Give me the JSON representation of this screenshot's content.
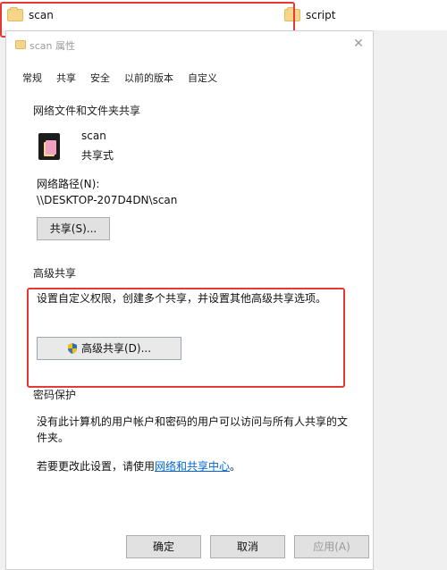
{
  "explorer": {
    "files": [
      {
        "name": "scan"
      },
      {
        "name": "script"
      }
    ]
  },
  "dialog": {
    "title": "scan 属性",
    "tabs": [
      "常规",
      "共享",
      "安全",
      "以前的版本",
      "自定义"
    ],
    "active_tab": "共享",
    "network_sharing": {
      "section_title": "网络文件和文件夹共享",
      "item_name": "scan",
      "item_status": "共享式",
      "path_label": "网络路径(N):",
      "path_value": "\\\\DESKTOP-207D4DN\\scan",
      "share_button": "共享(S)..."
    },
    "advanced_sharing": {
      "section_title": "高级共享",
      "description": "设置自定义权限，创建多个共享，并设置其他高级共享选项。",
      "button": "高级共享(D)..."
    },
    "password_protection": {
      "section_title": "密码保护",
      "description_line1": "没有此计算机的用户帐户和密码的用户可以访问与所有人共享的文",
      "description_line2": "件夹。",
      "change_prefix": "若要更改此设置，请使用",
      "change_link": "网络和共享中心",
      "change_suffix": "。"
    },
    "buttons": {
      "ok": "确定",
      "cancel": "取消",
      "apply": "应用(A)"
    }
  },
  "colors": {
    "highlight_box": "#e53935",
    "link": "#0066cc",
    "folder": "#f5d58a"
  }
}
